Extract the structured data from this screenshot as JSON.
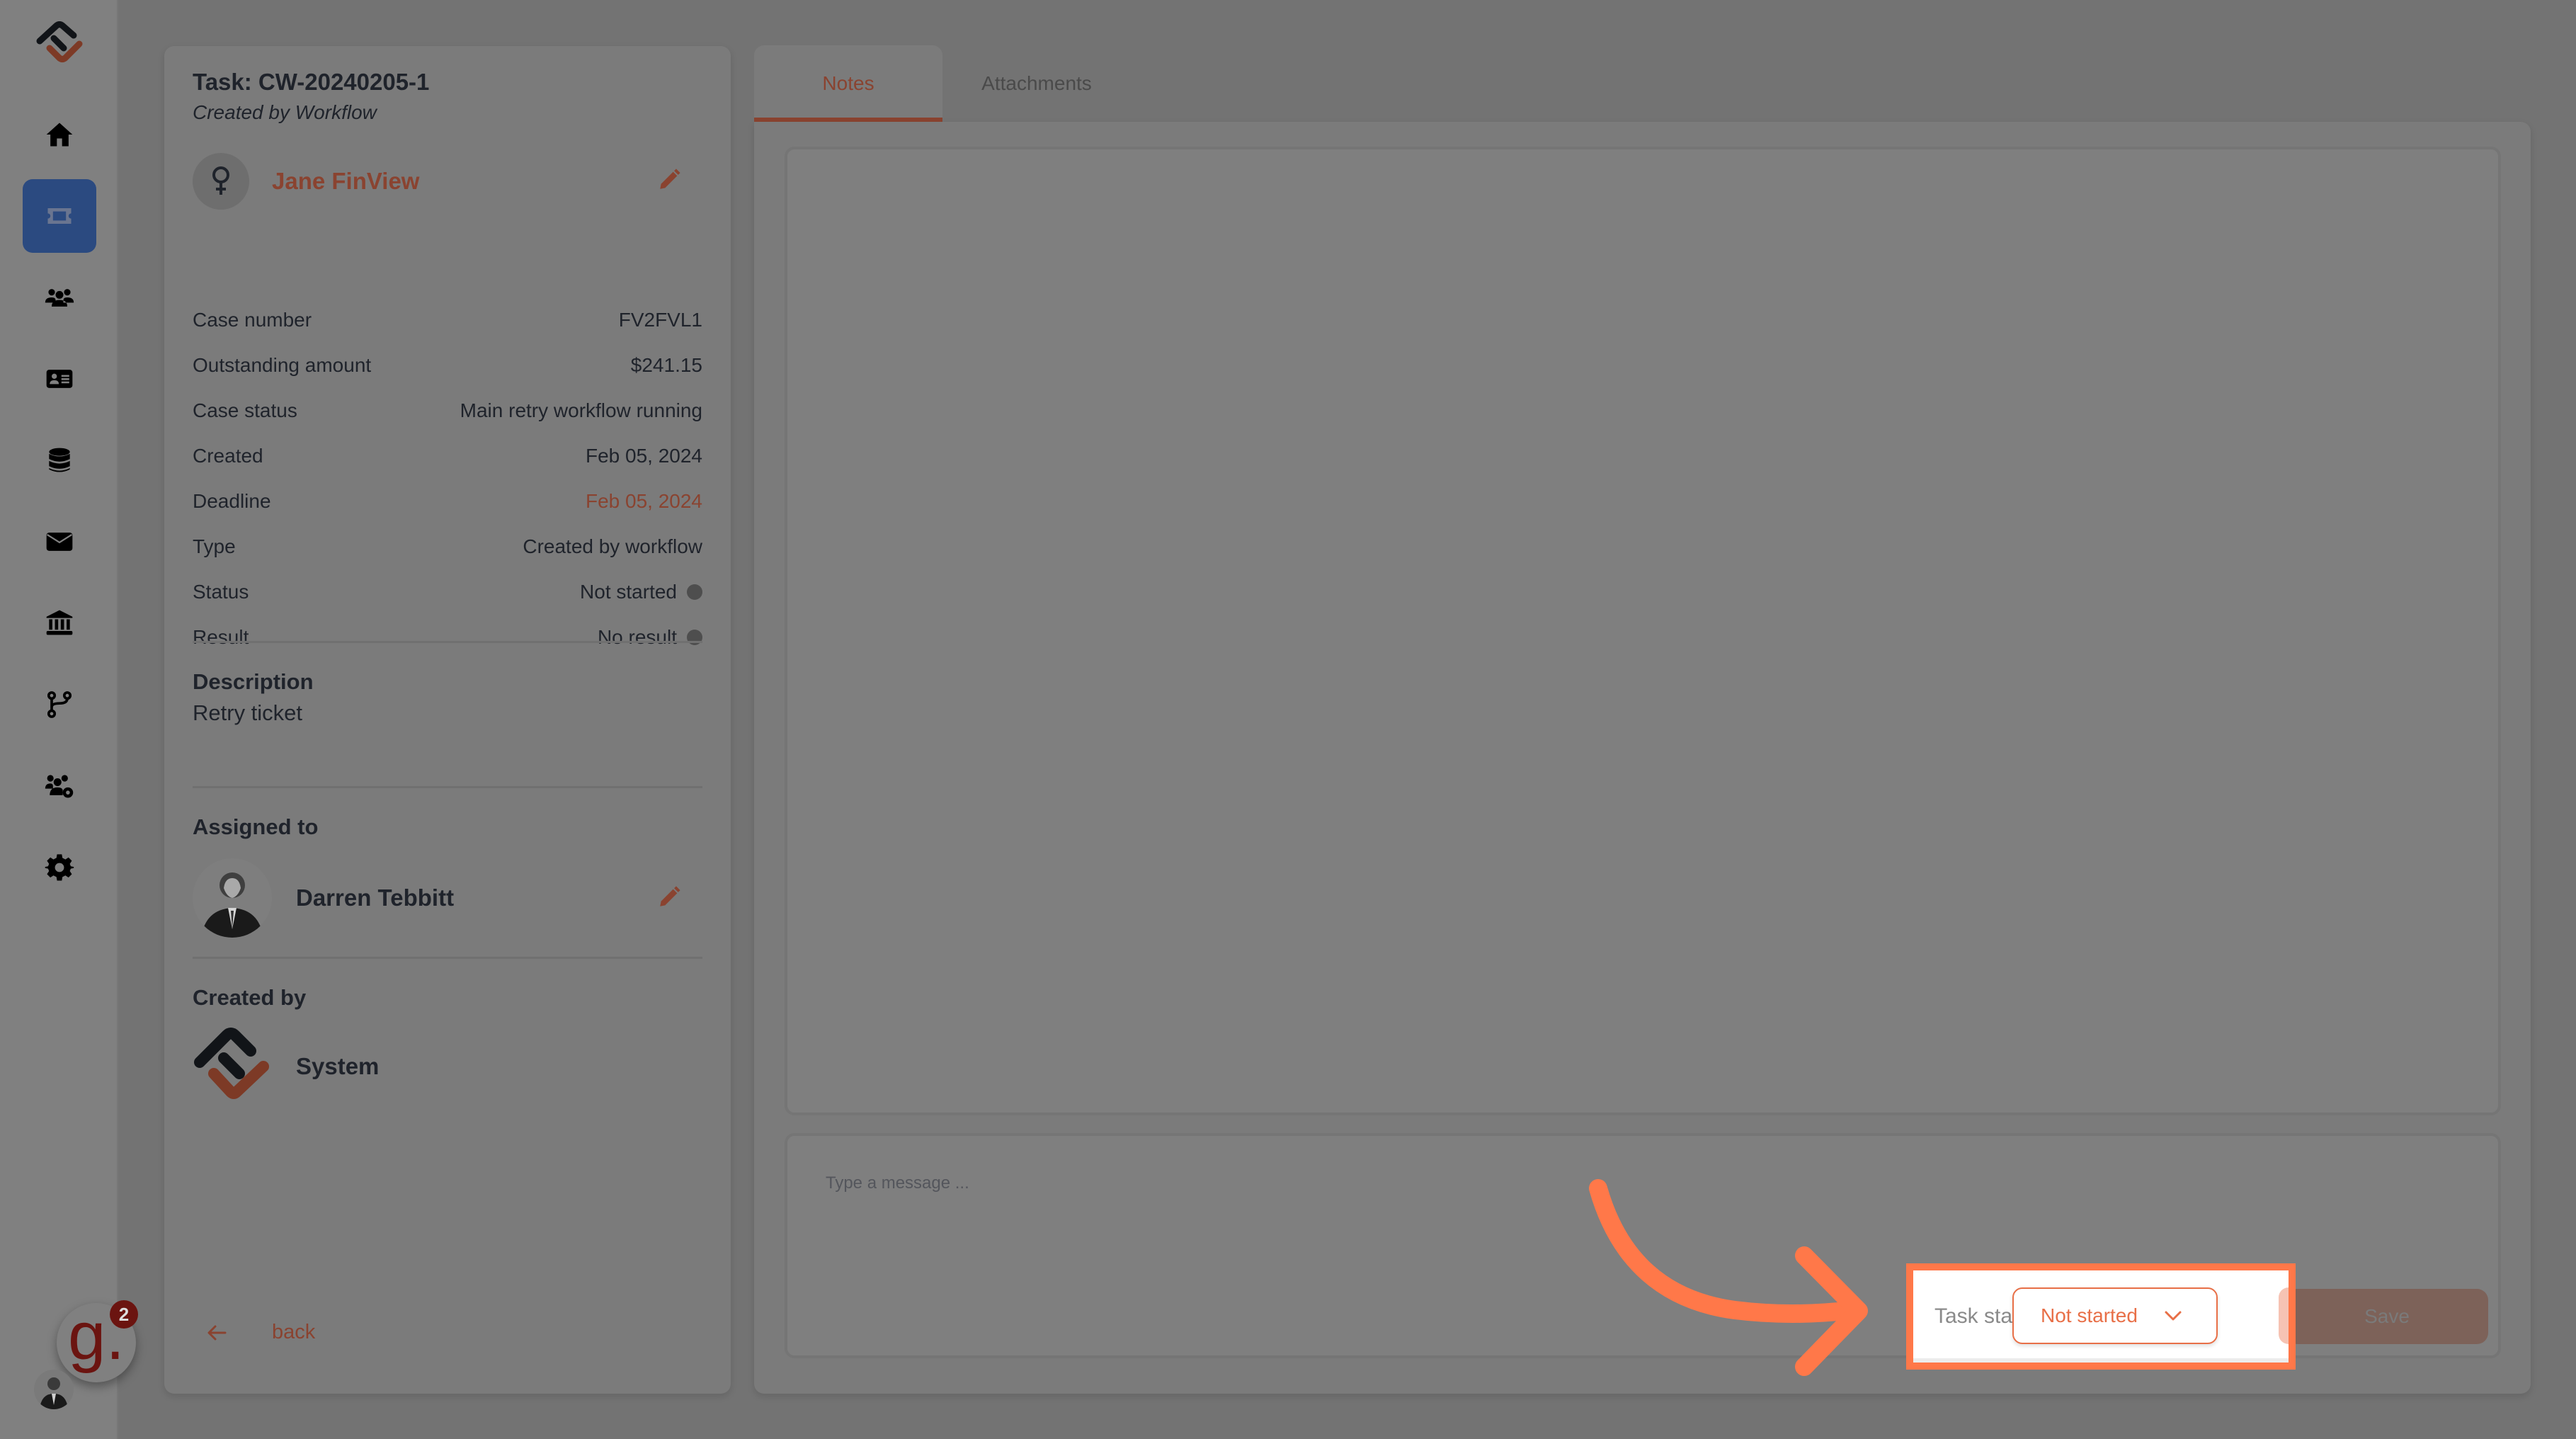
{
  "sidebar": {
    "items": [
      {
        "name": "home",
        "icon": "home-icon",
        "active": false
      },
      {
        "name": "tickets",
        "icon": "ticket-icon",
        "active": true
      },
      {
        "name": "customers",
        "icon": "users-icon",
        "active": false
      },
      {
        "name": "contacts",
        "icon": "id-card-icon",
        "active": false
      },
      {
        "name": "data",
        "icon": "database-icon",
        "active": false
      },
      {
        "name": "messages",
        "icon": "envelope-icon",
        "active": false
      },
      {
        "name": "banking",
        "icon": "bank-icon",
        "active": false
      },
      {
        "name": "workflows",
        "icon": "branch-icon",
        "active": false
      },
      {
        "name": "team-settings",
        "icon": "users-gear-icon",
        "active": false
      },
      {
        "name": "settings",
        "icon": "gear-icon",
        "active": false
      }
    ],
    "widget": {
      "letter": "g.",
      "badge_count": "2"
    }
  },
  "task": {
    "title": "Task: CW-20240205-1",
    "subtitle": "Created by Workflow",
    "customer_name": "Jane FinView",
    "details": [
      {
        "label": "Case number",
        "value": "FV2FVL1"
      },
      {
        "label": "Outstanding amount",
        "value": "$241.15"
      },
      {
        "label": "Case status",
        "value": "Main retry workflow running"
      },
      {
        "label": "Created",
        "value": "Feb 05, 2024"
      },
      {
        "label": "Deadline",
        "value": "Feb 05, 2024"
      },
      {
        "label": "Type",
        "value": "Created by workflow"
      },
      {
        "label": "Status",
        "value": "Not started"
      },
      {
        "label": "Result",
        "value": "No result"
      }
    ],
    "description_label": "Description",
    "description": "Retry ticket",
    "assigned_label": "Assigned to",
    "assigned_name": "Darren Tebbitt",
    "created_by_label": "Created by",
    "created_by_name": "System",
    "back_label": "back"
  },
  "tabs": [
    {
      "label": "Notes",
      "active": true
    },
    {
      "label": "Attachments",
      "active": false
    }
  ],
  "composer": {
    "placeholder": "Type a message ...",
    "task_status_label": "Task status",
    "task_status_value": "Not started",
    "save_label": "Save"
  },
  "colors": {
    "accent": "#8a4330",
    "highlight": "#ff7849",
    "active_nav": "#2b4a80"
  }
}
